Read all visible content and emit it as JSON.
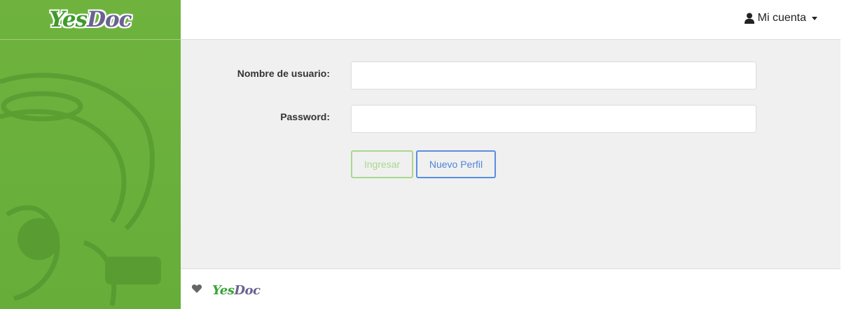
{
  "brand": {
    "logo_yes": "Yes",
    "logo_doc": "Doc"
  },
  "header": {
    "account_label": "Mi cuenta",
    "account_icon": "user-icon"
  },
  "login_form": {
    "username_label": "Nombre de usuario:",
    "username_value": "",
    "password_label": "Password:",
    "password_value": "",
    "login_button": "Ingresar",
    "new_profile_button": "Nuevo Perfil"
  },
  "footer": {
    "logo_yes": "Yes",
    "logo_doc": "Doc",
    "heart_icon": "heart-icon"
  },
  "colors": {
    "sidebar_green": "#6fb33e",
    "login_button_border": "#a8d88e",
    "new_profile_button_border": "#5b8de0",
    "logo_purple": "#6a6290"
  }
}
